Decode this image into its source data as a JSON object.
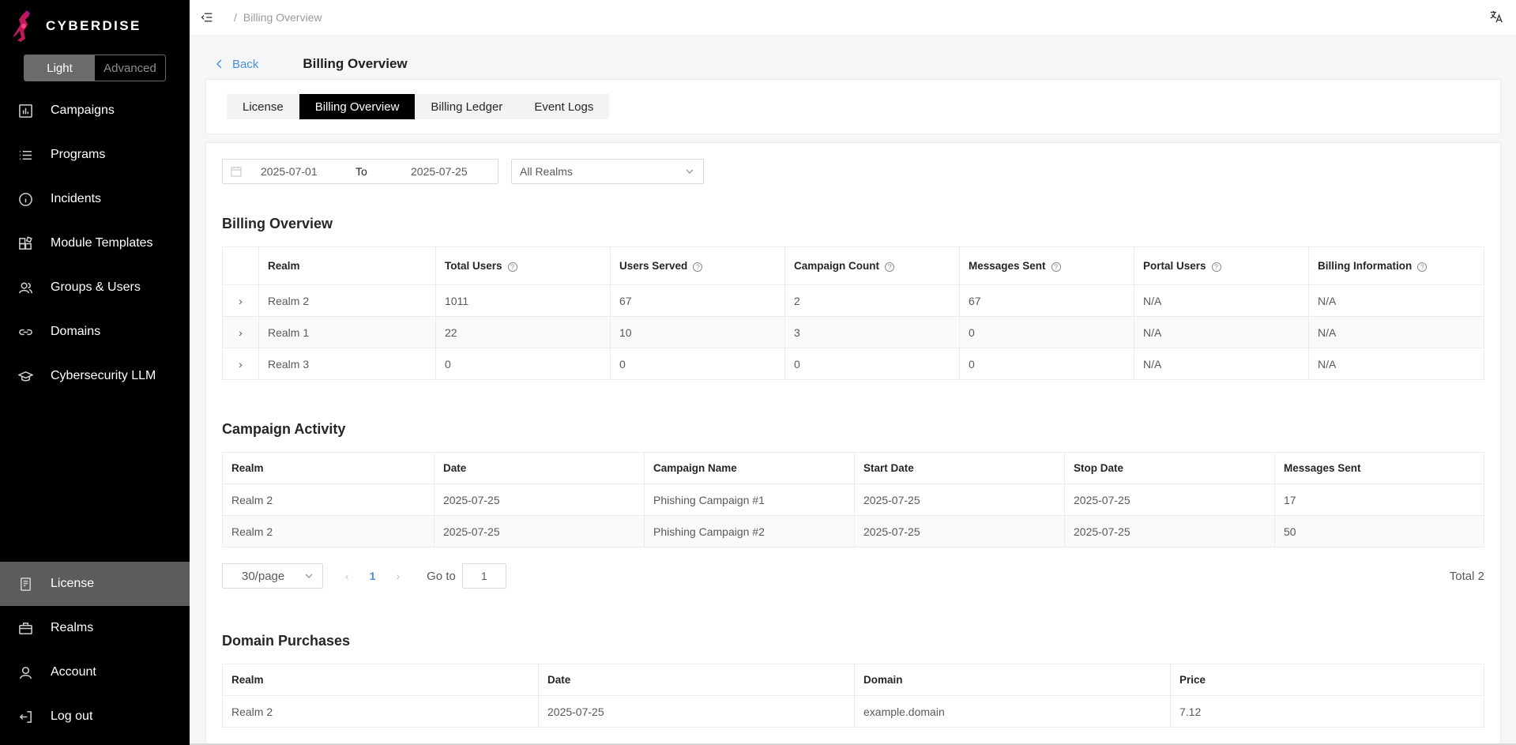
{
  "app": {
    "name": "CYBERDISE"
  },
  "mode_toggle": {
    "light": "Light",
    "advanced": "Advanced"
  },
  "sidebar": {
    "items": [
      {
        "label": "Campaigns",
        "icon": "bar-chart-icon"
      },
      {
        "label": "Programs",
        "icon": "list-icon"
      },
      {
        "label": "Incidents",
        "icon": "info-circle-icon"
      },
      {
        "label": "Module Templates",
        "icon": "module-grid-icon"
      },
      {
        "label": "Groups & Users",
        "icon": "users-icon"
      },
      {
        "label": "Domains",
        "icon": "link-icon"
      },
      {
        "label": "Cybersecurity LLM",
        "icon": "graduation-cap-icon"
      }
    ],
    "bottom_items": [
      {
        "label": "License",
        "icon": "document-icon",
        "active": true
      },
      {
        "label": "Realms",
        "icon": "briefcase-icon"
      },
      {
        "label": "Account",
        "icon": "user-icon"
      },
      {
        "label": "Log out",
        "icon": "logout-icon"
      }
    ]
  },
  "header": {
    "breadcrumb_sep": "/",
    "breadcrumb": "Billing Overview"
  },
  "page": {
    "back": "Back",
    "title": "Billing Overview"
  },
  "tabs": [
    {
      "label": "License",
      "active": false
    },
    {
      "label": "Billing Overview",
      "active": true
    },
    {
      "label": "Billing Ledger",
      "active": false
    },
    {
      "label": "Event Logs",
      "active": false
    }
  ],
  "filters": {
    "date_from": "2025-07-01",
    "date_to_label": "To",
    "date_to": "2025-07-25",
    "realm": "All Realms"
  },
  "billing_overview": {
    "title": "Billing Overview",
    "columns": [
      "Realm",
      "Total Users",
      "Users Served",
      "Campaign Count",
      "Messages Sent",
      "Portal Users",
      "Billing Information"
    ],
    "rows": [
      [
        "Realm 2",
        "1011",
        "67",
        "2",
        "67",
        "N/A",
        "N/A"
      ],
      [
        "Realm 1",
        "22",
        "10",
        "3",
        "0",
        "N/A",
        "N/A"
      ],
      [
        "Realm 3",
        "0",
        "0",
        "0",
        "0",
        "N/A",
        "N/A"
      ]
    ]
  },
  "campaign_activity": {
    "title": "Campaign Activity",
    "columns": [
      "Realm",
      "Date",
      "Campaign Name",
      "Start Date",
      "Stop Date",
      "Messages Sent"
    ],
    "rows": [
      [
        "Realm 2",
        "2025-07-25",
        "Phishing Campaign #1",
        "2025-07-25",
        "2025-07-25",
        "17"
      ],
      [
        "Realm 2",
        "2025-07-25",
        "Phishing Campaign #2",
        "2025-07-25",
        "2025-07-25",
        "50"
      ]
    ]
  },
  "pagination": {
    "page_size": "30/page",
    "current_page": "1",
    "goto_label": "Go to",
    "goto_value": "1",
    "total": "Total 2"
  },
  "domain_purchases": {
    "title": "Domain Purchases",
    "columns": [
      "Realm",
      "Date",
      "Domain",
      "Price"
    ],
    "rows": [
      [
        "Realm 2",
        "2025-07-25",
        "example.domain",
        "7.12"
      ]
    ]
  }
}
